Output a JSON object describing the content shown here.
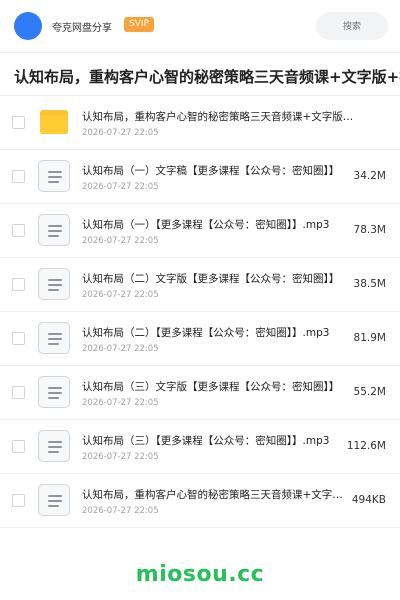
{
  "header": {
    "username": "夸克网盘分享",
    "badge": "SVIP",
    "search_placeholder": "搜索"
  },
  "title": "认知布局，重构客户心智的秘密策略三天音频课+文字版+视频",
  "files": [
    {
      "name": "认知布局，重构客户心智的秘密策略三天音频课+文字版…",
      "date": "2026-07-27 22:05",
      "size": "",
      "type": "folder"
    },
    {
      "name": "认知布局（一）文字稿【更多课程【公众号：密知圈】】",
      "date": "2026-07-27 22:05",
      "size": "34.2M",
      "type": "doc"
    },
    {
      "name": "认知布局（一）【更多课程【公众号：密知圈】】.mp3",
      "date": "2026-07-27 22:05",
      "size": "78.3M",
      "type": "doc"
    },
    {
      "name": "认知布局（二）文字版【更多课程【公众号：密知圈】】",
      "date": "2026-07-27 22:05",
      "size": "38.5M",
      "type": "doc"
    },
    {
      "name": "认知布局（二）【更多课程【公众号：密知圈】】.mp3",
      "date": "2026-07-27 22:05",
      "size": "81.9M",
      "type": "doc"
    },
    {
      "name": "认知布局（三）文字版【更多课程【公众号：密知圈】】",
      "date": "2026-07-27 22:05",
      "size": "55.2M",
      "type": "doc"
    },
    {
      "name": "认知布局（三）【更多课程【公众号：密知圈】】.mp3",
      "date": "2026-07-27 22:05",
      "size": "112.6M",
      "type": "doc"
    },
    {
      "name": "认知布局，重构客户心智的秘密策略三天音频课+文字版…",
      "date": "2026-07-27 22:05",
      "size": "494KB",
      "type": "doc"
    }
  ],
  "watermark": "miosou.cc",
  "colors": {
    "accent": "#2f7cf6",
    "badge": "#f7a23a",
    "folder": "#ffcc33",
    "watermark": "#26c15a"
  }
}
